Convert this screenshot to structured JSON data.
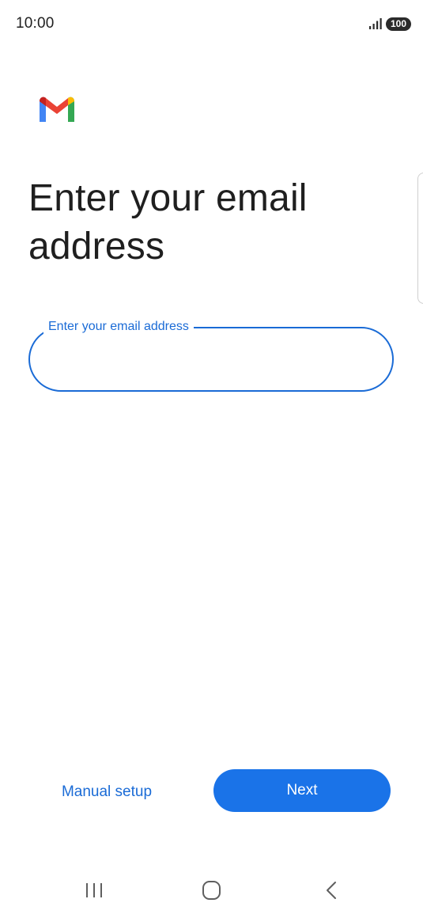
{
  "status_bar": {
    "time": "10:00",
    "battery_level": "100",
    "signal_icon": "signal-bars-icon"
  },
  "app": {
    "logo_icon": "gmail-logo-icon",
    "brand_colors": {
      "blue": "#4285f4",
      "red": "#ea4335",
      "yellow": "#fbbc04",
      "green": "#34a853"
    }
  },
  "main": {
    "title": "Enter your email address",
    "email_field": {
      "label": "Enter your email address",
      "value": "",
      "placeholder": ""
    }
  },
  "actions": {
    "manual_setup_label": "Manual setup",
    "next_label": "Next",
    "accent_color": "#1a73e8"
  },
  "nav_bar": {
    "recents_icon": "recents-icon",
    "home_icon": "home-icon",
    "back_icon": "back-icon"
  }
}
